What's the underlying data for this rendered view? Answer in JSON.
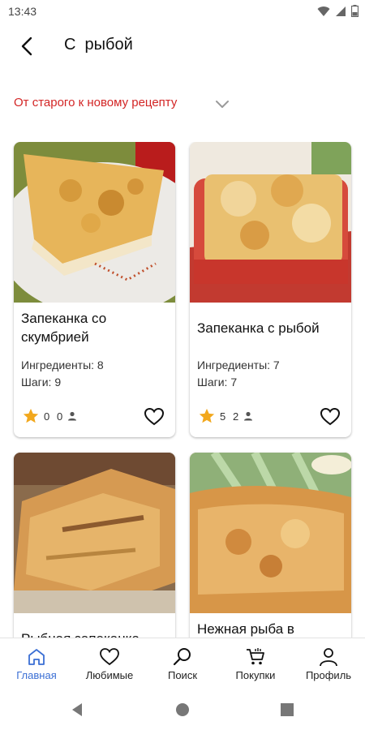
{
  "status_bar": {
    "time": "13:43"
  },
  "header": {
    "title": "С  рыбой"
  },
  "sort": {
    "label": "От старого к новому рецепту"
  },
  "recipes": [
    {
      "title": "Запеканка со скумбрией",
      "ingredients": "Ингредиенты: 8",
      "steps": "Шаги: 9",
      "rating": "0",
      "votes": "0"
    },
    {
      "title": "Запеканка с рыбой",
      "ingredients": "Ингредиенты: 7",
      "steps": "Шаги: 7",
      "rating": "5",
      "votes": "2"
    },
    {
      "title": "Рыбная запеканка",
      "ingredients": "",
      "steps": "",
      "rating": "",
      "votes": ""
    },
    {
      "title": "Нежная рыба в",
      "ingredients": "",
      "steps": "",
      "rating": "",
      "votes": ""
    }
  ],
  "bottom_nav": [
    {
      "label": "Главная",
      "icon": "home-icon",
      "active": true
    },
    {
      "label": "Любимые",
      "icon": "heart-icon",
      "active": false
    },
    {
      "label": "Поиск",
      "icon": "search-icon",
      "active": false
    },
    {
      "label": "Покупки",
      "icon": "cart-icon",
      "active": false
    },
    {
      "label": "Профиль",
      "icon": "profile-icon",
      "active": false
    }
  ],
  "colors": {
    "accent_red": "#d32525",
    "star": "#f2a81d",
    "nav_active": "#3b6fd4"
  }
}
